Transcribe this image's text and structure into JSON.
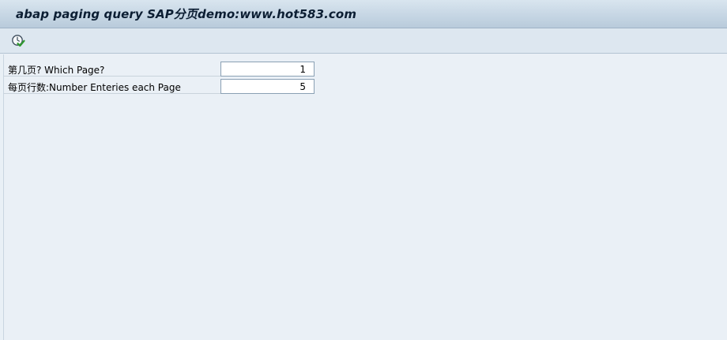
{
  "window": {
    "title": "abap paging query SAP分页demo:www.hot583.com"
  },
  "toolbar": {
    "execute_icon": "execute-clock-check-icon"
  },
  "form": {
    "rows": [
      {
        "label": "第几页? Which Page?",
        "value": "1"
      },
      {
        "label": "每页行数:Number Enteries each Page",
        "value": "5"
      }
    ]
  },
  "colors": {
    "background": "#eaf0f6",
    "title_bar": "#c6d6e4",
    "field_border": "#8aa0b4",
    "icon_green": "#2e9a2e"
  }
}
